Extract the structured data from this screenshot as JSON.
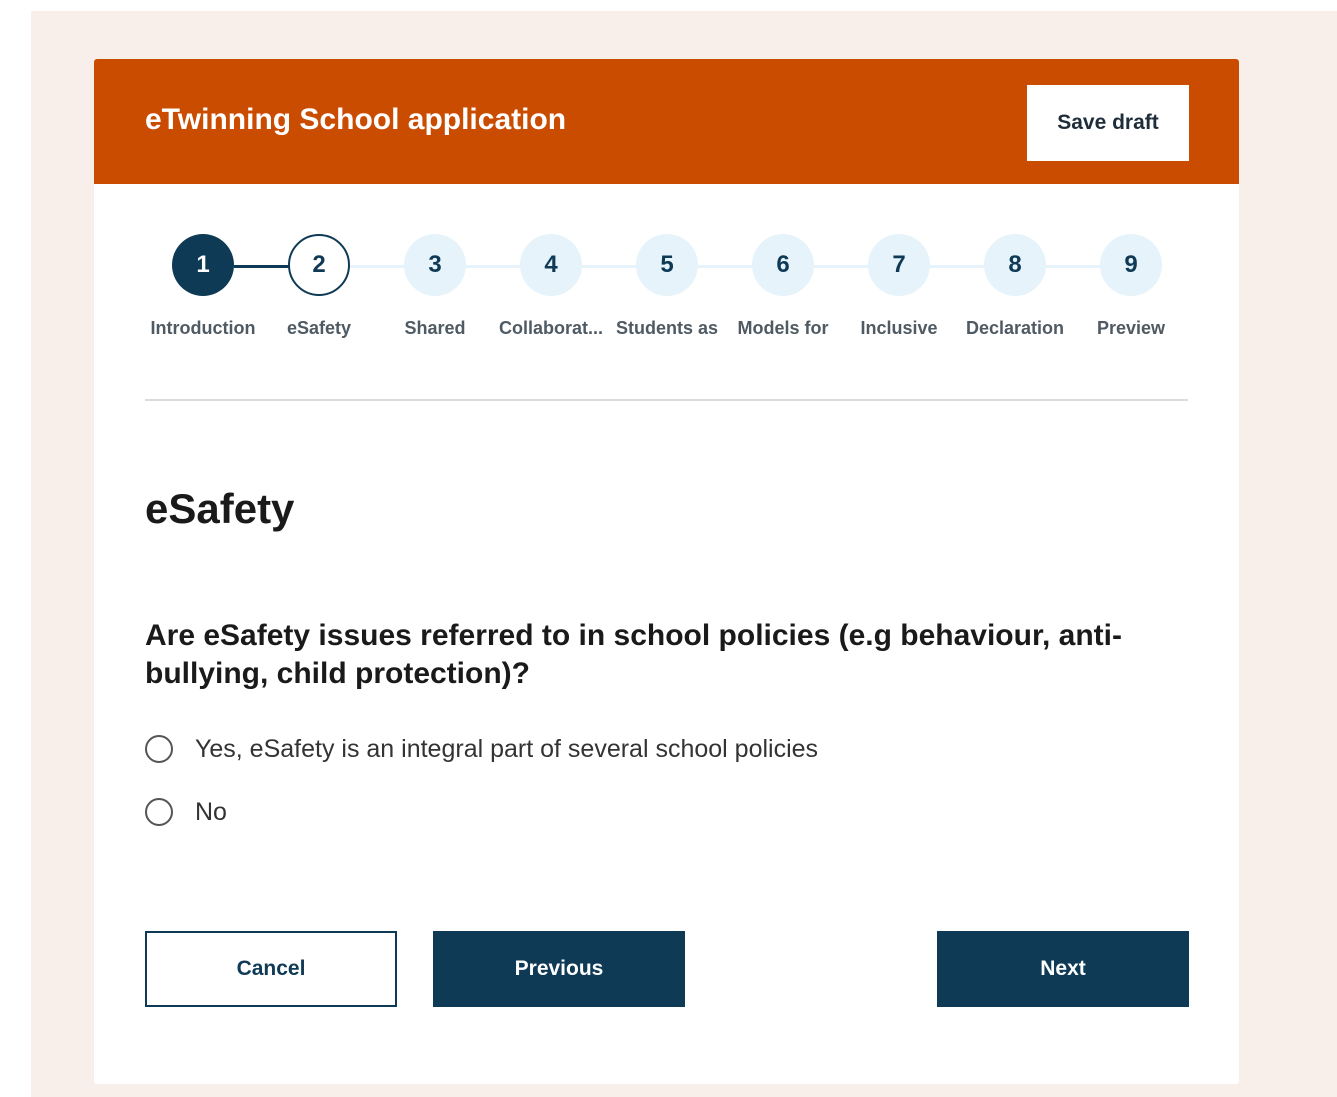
{
  "header": {
    "title": "eTwinning School application",
    "save_draft_label": "Save draft"
  },
  "colors": {
    "header_background": "#c94c00",
    "primary": "#0f3a56",
    "step_inactive": "#e6f3fa",
    "page_background": "#f8efea"
  },
  "stepper": {
    "steps": [
      {
        "number": "1",
        "label": "Introduction",
        "state": "completed"
      },
      {
        "number": "2",
        "label": "eSafety",
        "state": "current"
      },
      {
        "number": "3",
        "label": "Shared",
        "state": "upcoming"
      },
      {
        "number": "4",
        "label": "Collaborat...",
        "state": "upcoming"
      },
      {
        "number": "5",
        "label": "Students as",
        "state": "upcoming"
      },
      {
        "number": "6",
        "label": "Models for",
        "state": "upcoming"
      },
      {
        "number": "7",
        "label": "Inclusive",
        "state": "upcoming"
      },
      {
        "number": "8",
        "label": "Declaration",
        "state": "upcoming"
      },
      {
        "number": "9",
        "label": "Preview",
        "state": "upcoming"
      }
    ]
  },
  "section": {
    "title": "eSafety"
  },
  "question": {
    "text": "Are eSafety issues referred to in school policies (e.g behaviour, anti-bullying, child protection)?",
    "options": [
      {
        "label": "Yes, eSafety is an integral part of several school policies",
        "selected": false
      },
      {
        "label": "No",
        "selected": false
      }
    ]
  },
  "footer": {
    "cancel_label": "Cancel",
    "previous_label": "Previous",
    "next_label": "Next"
  }
}
